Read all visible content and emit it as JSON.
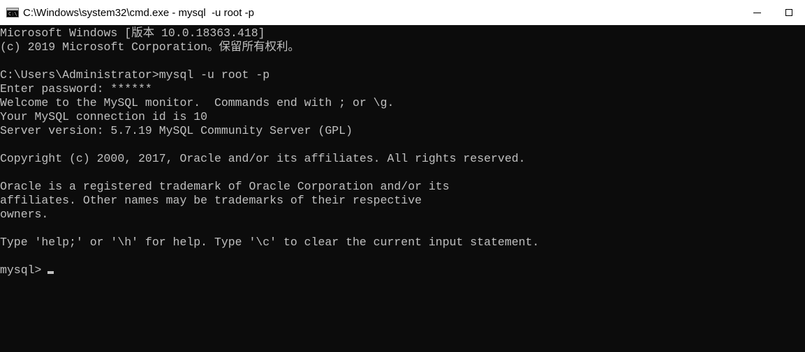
{
  "window": {
    "title": "C:\\Windows\\system32\\cmd.exe - mysql  -u root -p",
    "icon_name": "cmd-icon",
    "icon_text": "C:\\",
    "colors": {
      "console_bg": "#0c0c0c",
      "console_fg": "#c0c0c0",
      "titlebar_bg": "#ffffff"
    }
  },
  "console": {
    "lines": [
      "Microsoft Windows [版本 10.0.18363.418]",
      "(c) 2019 Microsoft Corporation。保留所有权利。",
      "",
      "C:\\Users\\Administrator>mysql -u root -p",
      "Enter password: ******",
      "Welcome to the MySQL monitor.  Commands end with ; or \\g.",
      "Your MySQL connection id is 10",
      "Server version: 5.7.19 MySQL Community Server (GPL)",
      "",
      "Copyright (c) 2000, 2017, Oracle and/or its affiliates. All rights reserved.",
      "",
      "Oracle is a registered trademark of Oracle Corporation and/or its",
      "affiliates. Other names may be trademarks of their respective",
      "owners.",
      "",
      "Type 'help;' or '\\h' for help. Type '\\c' to clear the current input statement.",
      ""
    ],
    "prompt": "mysql>"
  }
}
